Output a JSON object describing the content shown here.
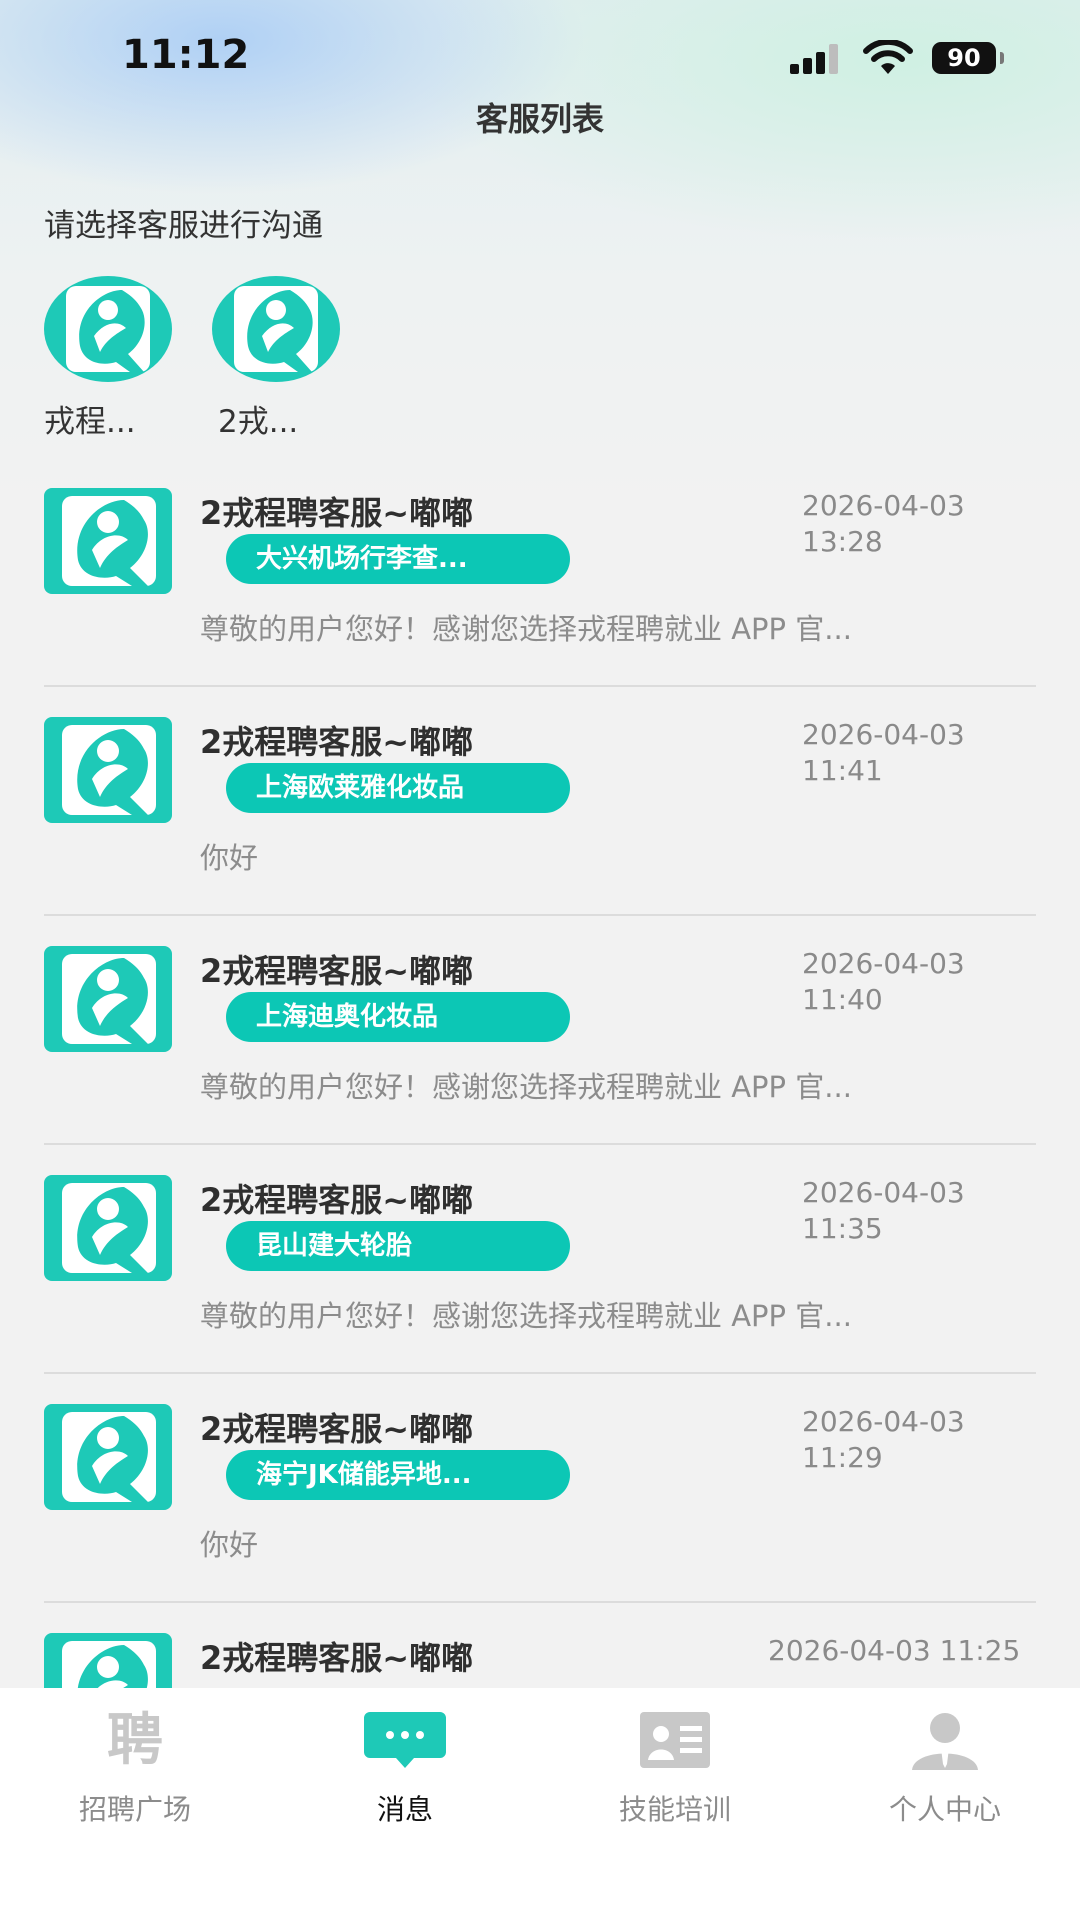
{
  "status_bar": {
    "time": "11:12",
    "battery": "90"
  },
  "nav": {
    "title": "客服列表"
  },
  "prompt": "请选择客服进行沟通",
  "agents": [
    {
      "name": "戎程..."
    },
    {
      "name": "2戎..."
    }
  ],
  "chats": [
    {
      "name": "2戎程聘客服~嘟嘟",
      "tag": "大兴机场行李查...",
      "date": "2026-04-03",
      "time": "13:28",
      "preview": "尊敬的用户您好！感谢您选择戎程聘就业 APP 官..."
    },
    {
      "name": "2戎程聘客服~嘟嘟",
      "tag": "上海欧莱雅化妆品",
      "date": "2026-04-03",
      "time": "11:41",
      "preview": "你好"
    },
    {
      "name": "2戎程聘客服~嘟嘟",
      "tag": "上海迪奥化妆品",
      "date": "2026-04-03",
      "time": "11:40",
      "preview": "尊敬的用户您好！感谢您选择戎程聘就业 APP 官..."
    },
    {
      "name": "2戎程聘客服~嘟嘟",
      "tag": "昆山建大轮胎",
      "date": "2026-04-03",
      "time": "11:35",
      "preview": "尊敬的用户您好！感谢您选择戎程聘就业 APP 官..."
    },
    {
      "name": "2戎程聘客服~嘟嘟",
      "tag": "海宁JK储能异地...",
      "date": "2026-04-03",
      "time": "11:29",
      "preview": "你好"
    },
    {
      "name": "2戎程聘客服~嘟嘟",
      "datetime": "2026-04-03 11:25"
    }
  ],
  "tabs": [
    {
      "label": "招聘广场",
      "icon": "recruit-icon",
      "glyph": "聘"
    },
    {
      "label": "消息",
      "icon": "message-icon"
    },
    {
      "label": "技能培训",
      "icon": "training-icon"
    },
    {
      "label": "个人中心",
      "icon": "profile-icon"
    }
  ],
  "colors": {
    "accent": "#0cc7b5",
    "avatar_bg": "#1ec9b7",
    "active_tab": "#1ec9b7",
    "inactive_tab": "#c8c8c8"
  }
}
